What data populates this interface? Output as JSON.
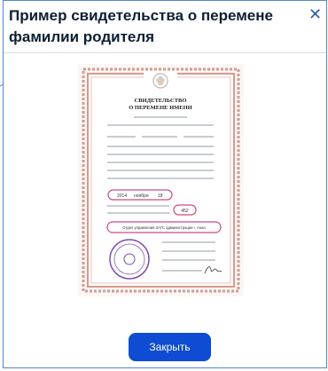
{
  "modal": {
    "title": "Пример свидетельства о перемене фамилии родителя",
    "close_icon": "close-icon",
    "close_button_label": "Закрыть"
  },
  "certificate": {
    "heading_line1": "СВИДЕТЕЛЬСТВО",
    "heading_line2": "О ПЕРЕМЕНЕ ИМЕНИ",
    "date_day": "2014",
    "date_month": "ноября",
    "date_year": "18",
    "record_number": "452",
    "office": "Отдел управления ЗАГС администрации г. Анап",
    "emblem_icon": "coat-of-arms-icon",
    "stamp_icon": "stamp-icon",
    "signature_icon": "signature-icon"
  },
  "colors": {
    "accent": "#0d4cd3",
    "border": "#4f87d3",
    "frame": "#d79a8e",
    "highlight": "#c94a8a",
    "stamp": "#7b4fb5"
  }
}
